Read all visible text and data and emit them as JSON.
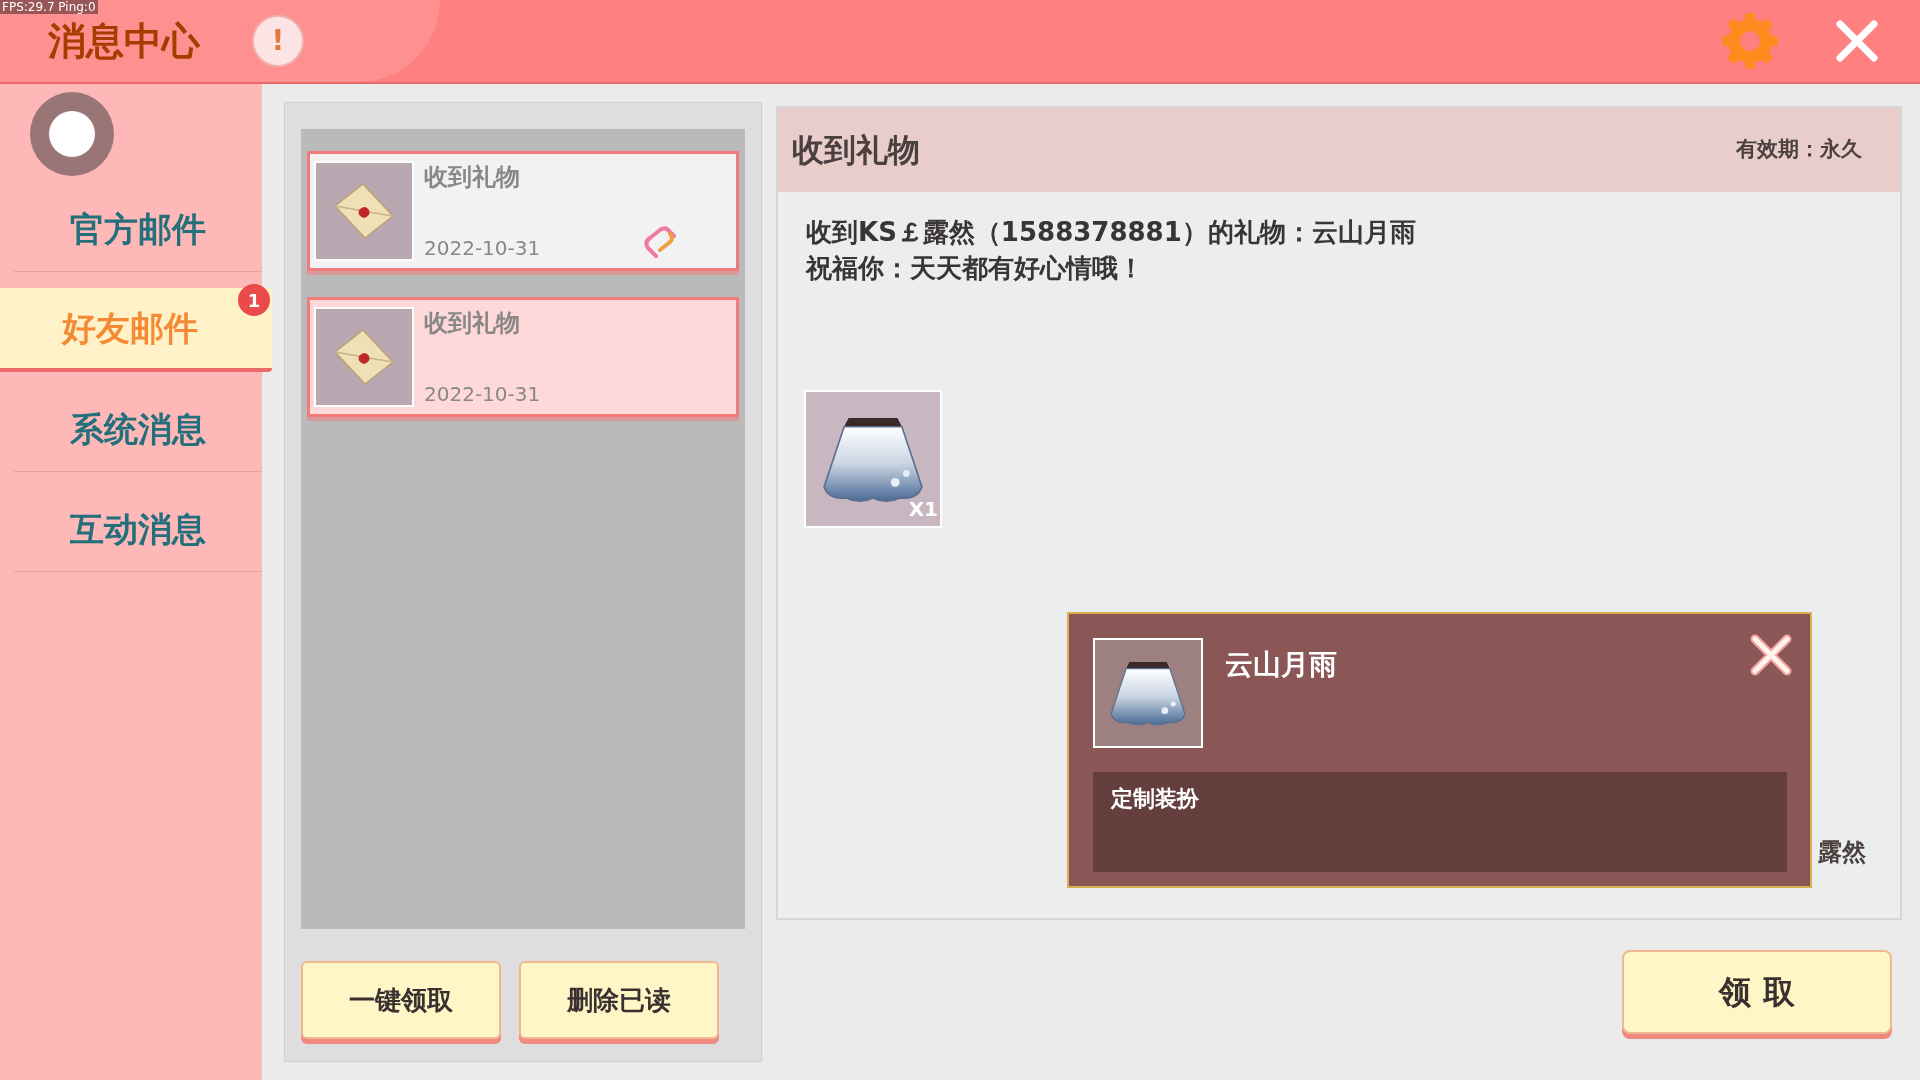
{
  "debug_overlay": "FPS:29.7 Ping:0",
  "header": {
    "title": "消息中心",
    "alert_badge": "!"
  },
  "sidebar": {
    "tabs": [
      {
        "label": "官方邮件",
        "selected": false
      },
      {
        "label": "好友邮件",
        "selected": true,
        "badge": "1"
      },
      {
        "label": "系统消息",
        "selected": false
      },
      {
        "label": "互动消息",
        "selected": false
      }
    ]
  },
  "mail_list": {
    "items": [
      {
        "title": "收到礼物",
        "date": "2022-10-31",
        "has_attachment": true,
        "selected": false
      },
      {
        "title": "收到礼物",
        "date": "2022-10-31",
        "has_attachment": false,
        "selected": true
      }
    ]
  },
  "list_buttons": [
    "一键领取",
    "删除已读"
  ],
  "detail": {
    "title": "收到礼物",
    "validity": "有效期：永久",
    "body": [
      "收到KS￡露然（1588378881）的礼物：云山月雨",
      "祝福你：天天都有好心情哦！"
    ],
    "attachments": [
      {
        "quantity": "X1"
      }
    ],
    "sender": "露然",
    "claim_button": "领 取"
  },
  "popup": {
    "item_name": "云山月雨",
    "description": "定制装扮"
  }
}
